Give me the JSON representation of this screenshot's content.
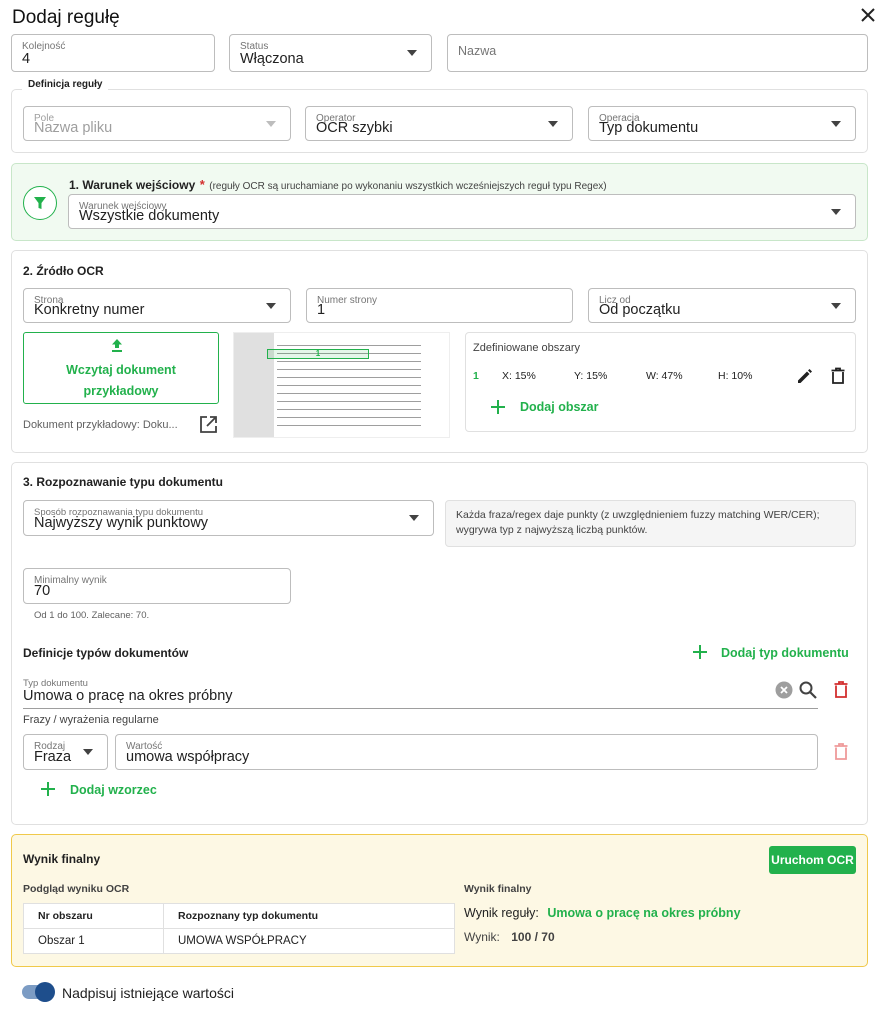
{
  "dialog": {
    "title": "Dodaj regułę"
  },
  "top": {
    "order": {
      "label": "Kolejność",
      "value": "4"
    },
    "status": {
      "label": "Status",
      "value": "Włączona"
    },
    "name": {
      "placeholder": "Nazwa"
    }
  },
  "definition": {
    "title": "Definicja reguły",
    "field": {
      "label": "Pole",
      "value": "Nazwa pliku"
    },
    "operator": {
      "label": "Operator",
      "value": "OCR szybki"
    },
    "operation": {
      "label": "Operacja",
      "value": "Typ dokumentu"
    }
  },
  "entry": {
    "title": "1. Warunek wejściowy",
    "required": "*",
    "note": "(reguły OCR są uruchamiane po wykonaniu wszystkich wcześniejszych reguł typu Regex)",
    "select": {
      "label": "Warunek wejściowy",
      "value": "Wszystkie dokumenty"
    }
  },
  "source": {
    "title": "2. Źródło OCR",
    "page": {
      "label": "Strona",
      "value": "Konkretny numer"
    },
    "page_number": {
      "label": "Numer strony",
      "value": "1"
    },
    "count_from": {
      "label": "Licz od",
      "value": "Od początku"
    },
    "upload_label_1": "Wczytaj dokument",
    "upload_label_2": "przykładowy",
    "sample_doc": "Dokument przykładowy: Doku...",
    "preview_region_label": "1",
    "areas": {
      "title": "Zdefiniowane obszary",
      "items": [
        {
          "num": "1",
          "x": "X: 15%",
          "y": "Y: 15%",
          "w": "W: 47%",
          "h": "H: 10%"
        }
      ],
      "add_label": "Dodaj obszar"
    }
  },
  "recognition": {
    "title": "3. Rozpoznawanie typu dokumentu",
    "method": {
      "label": "Sposób rozpoznawania typu dokumentu",
      "value": "Najwyższy wynik punktowy"
    },
    "info": "Każda fraza/regex daje punkty (z uwzględnieniem fuzzy matching WER/CER); wygrywa typ z najwyższą liczbą punktów.",
    "min_score": {
      "label": "Minimalny wynik",
      "value": "70",
      "hint": "Od 1 do 100. Zalecane: 70."
    },
    "types_title": "Definicje typów dokumentów",
    "add_type_label": "Dodaj typ dokumentu",
    "doc_type": {
      "label": "Typ dokumentu",
      "value": "Umowa o pracę na okres próbny"
    },
    "phrases_title": "Frazy / wyrażenia regularne",
    "pattern": {
      "kind_label": "Rodzaj",
      "kind_value": "Fraza",
      "value_label": "Wartość",
      "value_value": "umowa współpracy"
    },
    "add_pattern_label": "Dodaj wzorzec"
  },
  "final": {
    "title": "Wynik finalny",
    "run_button": "Uruchom OCR",
    "preview_title": "Podgląd wyniku OCR",
    "table": {
      "headers": [
        "Nr obszaru",
        "Rozpoznany typ dokumentu"
      ],
      "rows": [
        [
          "Obszar 1",
          "UMOWA WSPÓŁPRACY"
        ]
      ]
    },
    "result_title": "Wynik finalny",
    "rule_result_label": "Wynik reguły:",
    "rule_result_value": "Umowa o pracę na okres próbny",
    "score_label": "Wynik:",
    "score_value": "100 / 70"
  },
  "overwrite": {
    "label": "Nadpisuj istniejące wartości",
    "enabled": true
  },
  "colors": {
    "accent_green": "#22b14c",
    "toggle_blue": "#1e4e8c",
    "danger_red": "#d32f2f",
    "final_bg": "#fdf8e4",
    "final_border": "#f0c94a"
  }
}
